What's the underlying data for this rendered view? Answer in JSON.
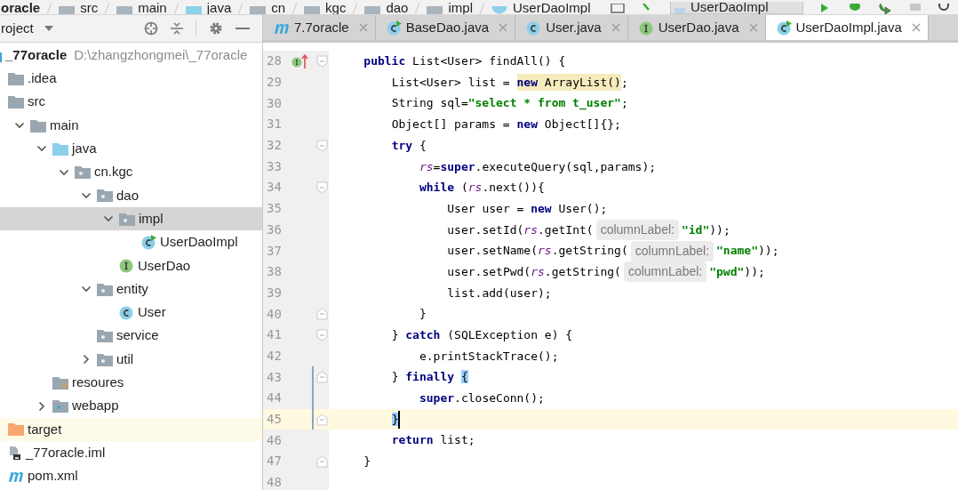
{
  "breadcrumb": [
    {
      "label": "oracle"
    },
    {
      "label": "src",
      "kind": "folder"
    },
    {
      "label": "main",
      "kind": "folder"
    },
    {
      "label": "java",
      "kind": "source-folder"
    },
    {
      "label": "cn",
      "kind": "package"
    },
    {
      "label": "kgc",
      "kind": "package"
    },
    {
      "label": "dao",
      "kind": "package"
    },
    {
      "label": "impl",
      "kind": "package"
    },
    {
      "label": "UserDaoImpl",
      "kind": "class"
    }
  ],
  "run_config": {
    "label": "UserDaoImpl"
  },
  "project_panel": {
    "title": "roject"
  },
  "tree": [
    {
      "label": "_77oracle",
      "path": "D:\\zhangzhongmei\\_77oracle",
      "kind": "module",
      "selected": false,
      "children": [
        {
          "label": ".idea",
          "kind": "folder",
          "selected": false
        },
        {
          "label": "src",
          "kind": "folder",
          "selected": false,
          "children": [
            {
              "label": "main",
              "kind": "folder",
              "expanded": true,
              "selected": false,
              "children": [
                {
                  "label": "java",
                  "kind": "source-folder",
                  "expanded": true,
                  "selected": false,
                  "children": [
                    {
                      "label": "cn.kgc",
                      "kind": "package",
                      "expanded": true,
                      "selected": false,
                      "children": [
                        {
                          "label": "dao",
                          "kind": "package",
                          "expanded": true,
                          "selected": false,
                          "children": [
                            {
                              "label": "impl",
                              "kind": "package",
                              "expanded": true,
                              "selected": true,
                              "children": [
                                {
                                  "label": "UserDaoImpl",
                                  "kind": "runnable-class",
                                  "selected": false
                                }
                              ]
                            },
                            {
                              "label": "UserDao",
                              "kind": "interface",
                              "selected": false
                            }
                          ]
                        },
                        {
                          "label": "entity",
                          "kind": "package",
                          "expanded": true,
                          "selected": false,
                          "children": [
                            {
                              "label": "User",
                              "kind": "class",
                              "selected": false
                            }
                          ]
                        },
                        {
                          "label": "service",
                          "kind": "package",
                          "selected": false
                        },
                        {
                          "label": "util",
                          "kind": "package",
                          "expanded": false,
                          "selected": false
                        }
                      ]
                    }
                  ]
                },
                {
                  "label": "resoures",
                  "kind": "resources-folder",
                  "selected": false
                },
                {
                  "label": "webapp",
                  "kind": "web-folder",
                  "expanded": false,
                  "selected": false
                }
              ]
            }
          ]
        },
        {
          "label": "target",
          "kind": "excluded-folder",
          "selected": false
        },
        {
          "label": "_77oracle.iml",
          "kind": "iml-file",
          "selected": false
        },
        {
          "label": "pom.xml",
          "kind": "maven-file",
          "selected": false
        }
      ]
    }
  ],
  "tabs": [
    {
      "label": "7.7oracle",
      "kind": "maven",
      "selected": false
    },
    {
      "label": "BaseDao.java",
      "kind": "runnable-class",
      "selected": false
    },
    {
      "label": "User.java",
      "kind": "class",
      "selected": false
    },
    {
      "label": "UserDao.java",
      "kind": "interface",
      "selected": false
    },
    {
      "label": "UserDaoImpl.java",
      "kind": "runnable-class",
      "selected": true
    }
  ],
  "code_lines": [
    {
      "number": "28",
      "gutter_icon": {
        "kind": "implements"
      },
      "fold_marker": {
        "kind": "start"
      },
      "changed": false,
      "current": false,
      "tokens": [
        {
          "kind": "keyword",
          "text": "    public"
        },
        {
          "kind": "plain",
          "text": " List<User> findAll() {"
        }
      ]
    },
    {
      "number": "29",
      "changed": false,
      "current": false,
      "tokens": [
        {
          "kind": "plain",
          "text": "        List<User> list = "
        },
        {
          "kind": "warning-keyword",
          "text": "new"
        },
        {
          "kind": "warning",
          "text": " ArrayList()"
        },
        {
          "kind": "plain",
          "text": ";"
        }
      ]
    },
    {
      "number": "30",
      "changed": false,
      "current": false,
      "tokens": [
        {
          "kind": "plain",
          "text": "        String sql="
        },
        {
          "kind": "string",
          "text": "\"select * from t_user\""
        },
        {
          "kind": "plain",
          "text": ";"
        }
      ]
    },
    {
      "number": "31",
      "changed": false,
      "current": false,
      "tokens": [
        {
          "kind": "plain",
          "text": "        Object[] params = "
        },
        {
          "kind": "keyword",
          "text": "new"
        },
        {
          "kind": "plain",
          "text": " Object[]{};"
        }
      ]
    },
    {
      "number": "32",
      "fold_marker": {
        "kind": "start"
      },
      "changed": false,
      "current": false,
      "tokens": [
        {
          "kind": "keyword",
          "text": "        try"
        },
        {
          "kind": "plain",
          "text": " {"
        }
      ]
    },
    {
      "number": "33",
      "changed": false,
      "current": false,
      "tokens": [
        {
          "kind": "field",
          "text": "            rs"
        },
        {
          "kind": "plain",
          "text": "="
        },
        {
          "kind": "keyword",
          "text": "super"
        },
        {
          "kind": "plain",
          "text": ".executeQuery(sql,params);"
        }
      ]
    },
    {
      "number": "34",
      "fold_marker": {
        "kind": "start"
      },
      "changed": false,
      "current": false,
      "tokens": [
        {
          "kind": "keyword",
          "text": "            while"
        },
        {
          "kind": "plain",
          "text": " ("
        },
        {
          "kind": "field",
          "text": "rs"
        },
        {
          "kind": "plain",
          "text": ".next()){"
        }
      ]
    },
    {
      "number": "35",
      "changed": false,
      "current": false,
      "tokens": [
        {
          "kind": "plain",
          "text": "                User user = "
        },
        {
          "kind": "keyword",
          "text": "new"
        },
        {
          "kind": "plain",
          "text": " User();"
        }
      ]
    },
    {
      "number": "36",
      "changed": false,
      "current": false,
      "tokens": [
        {
          "kind": "plain",
          "text": "                user.setId("
        },
        {
          "kind": "field",
          "text": "rs"
        },
        {
          "kind": "plain",
          "text": ".getInt("
        },
        {
          "kind": "hint",
          "text": "columnLabel:"
        },
        {
          "kind": "string",
          "text": "\"id\""
        },
        {
          "kind": "plain",
          "text": "));"
        }
      ]
    },
    {
      "number": "37",
      "changed": false,
      "current": false,
      "tokens": [
        {
          "kind": "plain",
          "text": "                user.setName("
        },
        {
          "kind": "field",
          "text": "rs"
        },
        {
          "kind": "plain",
          "text": ".getString("
        },
        {
          "kind": "hint",
          "text": "columnLabel:"
        },
        {
          "kind": "string",
          "text": "\"name\""
        },
        {
          "kind": "plain",
          "text": "));"
        }
      ]
    },
    {
      "number": "38",
      "changed": false,
      "current": false,
      "tokens": [
        {
          "kind": "plain",
          "text": "                user.setPwd("
        },
        {
          "kind": "field",
          "text": "rs"
        },
        {
          "kind": "plain",
          "text": ".getString("
        },
        {
          "kind": "hint",
          "text": "columnLabel:"
        },
        {
          "kind": "string",
          "text": "\"pwd\""
        },
        {
          "kind": "plain",
          "text": "));"
        }
      ]
    },
    {
      "number": "39",
      "changed": false,
      "current": false,
      "tokens": [
        {
          "kind": "plain",
          "text": "                list.add(user);"
        }
      ]
    },
    {
      "number": "40",
      "fold_marker": {
        "kind": "end"
      },
      "changed": false,
      "current": false,
      "tokens": [
        {
          "kind": "plain",
          "text": "            }"
        }
      ]
    },
    {
      "number": "41",
      "fold_marker": {
        "kind": "start"
      },
      "changed": false,
      "current": false,
      "tokens": [
        {
          "kind": "plain",
          "text": "        } "
        },
        {
          "kind": "keyword",
          "text": "catch"
        },
        {
          "kind": "plain",
          "text": " (SQLException e) {"
        }
      ]
    },
    {
      "number": "42",
      "changed": false,
      "current": false,
      "tokens": [
        {
          "kind": "plain",
          "text": "            e.printStackTrace();"
        }
      ]
    },
    {
      "number": "43",
      "fold_marker": {
        "kind": "end"
      },
      "changed": true,
      "current": false,
      "tokens": [
        {
          "kind": "plain",
          "text": "        } "
        },
        {
          "kind": "keyword",
          "text": "finally"
        },
        {
          "kind": "matched-brace",
          "text": " {"
        }
      ]
    },
    {
      "number": "44",
      "changed": true,
      "current": false,
      "tokens": [
        {
          "kind": "keyword",
          "text": "            super"
        },
        {
          "kind": "plain",
          "text": ".closeConn();"
        }
      ]
    },
    {
      "number": "45",
      "fold_marker": {
        "kind": "end"
      },
      "changed": true,
      "current": true,
      "tokens": [
        {
          "kind": "matched-brace",
          "text": "        }"
        }
      ]
    },
    {
      "number": "46",
      "changed": false,
      "current": false,
      "tokens": [
        {
          "kind": "keyword",
          "text": "        return"
        },
        {
          "kind": "plain",
          "text": " list;"
        }
      ]
    },
    {
      "number": "47",
      "fold_marker": {
        "kind": "end"
      },
      "changed": false,
      "current": false,
      "tokens": [
        {
          "kind": "plain",
          "text": "    }"
        }
      ]
    },
    {
      "number": "48",
      "changed": false,
      "current": false
    }
  ]
}
